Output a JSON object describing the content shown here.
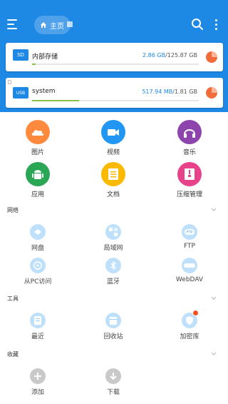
{
  "header": {
    "home_label": "主页"
  },
  "storage": [
    {
      "name": "内部存储",
      "used": "2.86 GB",
      "total": "/125.87 GB",
      "progress": 0.023,
      "icon": "sd-card-icon",
      "icon_text": "SD"
    },
    {
      "name": "system",
      "used": "517.94 MB",
      "total": "/1.81 GB",
      "progress": 0.28,
      "icon": "usb-icon",
      "icon_text": "USB"
    }
  ],
  "categories": [
    {
      "label": "图片",
      "icon": "picture-icon",
      "color": "#ff8a3d"
    },
    {
      "label": "视频",
      "icon": "video-icon",
      "color": "#2196f3"
    },
    {
      "label": "音乐",
      "icon": "headphones-icon",
      "color": "#8e44ad"
    },
    {
      "label": "应用",
      "icon": "android-icon",
      "color": "#2aa654"
    },
    {
      "label": "文档",
      "icon": "document-icon",
      "color": "#fbb900"
    },
    {
      "label": "压缩管理",
      "icon": "archive-icon",
      "color": "#e8428a"
    }
  ],
  "sections": {
    "network": "网络",
    "tools": "工具",
    "favorites": "收藏"
  },
  "network": [
    {
      "label": "网盘",
      "icon": "cloud-drive-icon"
    },
    {
      "label": "局域网",
      "icon": "lan-icon"
    },
    {
      "label": "FTP",
      "icon": "ftp-icon"
    },
    {
      "label": "从PC访问",
      "icon": "pc-access-icon"
    },
    {
      "label": "蓝牙",
      "icon": "bluetooth-icon"
    },
    {
      "label": "WebDAV",
      "icon": "webdav-icon"
    }
  ],
  "tools": [
    {
      "label": "最近",
      "icon": "recent-icon"
    },
    {
      "label": "回收站",
      "icon": "recycle-bin-icon"
    },
    {
      "label": "加密库",
      "icon": "vault-icon"
    }
  ],
  "favorites": [
    {
      "label": "添加",
      "icon": "add-icon"
    },
    {
      "label": "下载",
      "icon": "download-icon"
    }
  ]
}
